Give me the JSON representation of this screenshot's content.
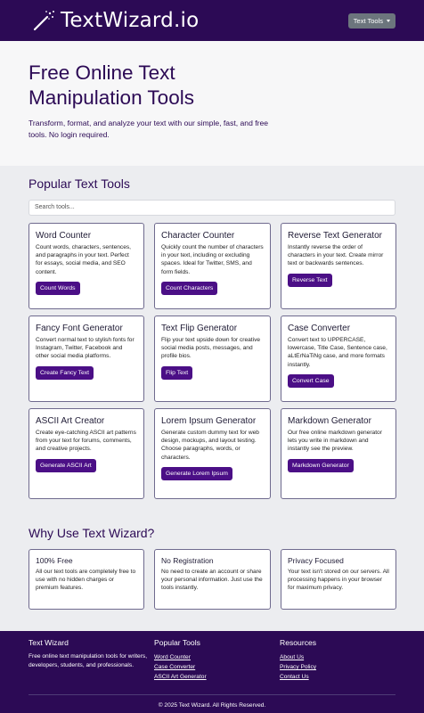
{
  "navbar": {
    "brand": "TextWizard.io",
    "dropdown_label": "Text Tools"
  },
  "hero": {
    "title": "Free Online Text Manipulation Tools",
    "subtitle": "Transform, format, and analyze your text with our simple, fast, and free tools. No login required."
  },
  "tools": {
    "title": "Popular Text Tools",
    "search_placeholder": "Search tools...",
    "cards": [
      {
        "title": "Word Counter",
        "desc": "Count words, characters, sentences, and paragraphs in your text. Perfect for essays, social media, and SEO content.",
        "button": "Count Words"
      },
      {
        "title": "Character Counter",
        "desc": "Quickly count the number of characters in your text, including or excluding spaces. Ideal for Twitter, SMS, and form fields.",
        "button": "Count Characters"
      },
      {
        "title": "Reverse Text Generator",
        "desc": "Instantly reverse the order of characters in your text. Create mirror text or backwards sentences.",
        "button": "Reverse Text"
      },
      {
        "title": "Fancy Font Generator",
        "desc": "Convert normal text to stylish fonts for Instagram, Twitter, Facebook and other social media platforms.",
        "button": "Create Fancy Text"
      },
      {
        "title": "Text Flip Generator",
        "desc": "Flip your text upside down for creative social media posts, messages, and profile bios.",
        "button": "Flip Text"
      },
      {
        "title": "Case Converter",
        "desc": "Convert text to UPPERCASE, lowercase, Title Case, Sentence case, aLtErNaTiNg case, and more formats instantly.",
        "button": "Convert Case"
      },
      {
        "title": "ASCII Art Creator",
        "desc": "Create eye-catching ASCII art patterns from your text for forums, comments, and creative projects.",
        "button": "Generate ASCII Art"
      },
      {
        "title": "Lorem Ipsum Generator",
        "desc": "Generate custom dummy text for web design, mockups, and layout testing. Choose paragraphs, words, or characters.",
        "button": "Generate Lorem Ipsum"
      },
      {
        "title": "Markdown Generator",
        "desc": "Our free online markdown generator lets you write in markdown and instantly see the preview.",
        "button": "Markdown Generator"
      }
    ]
  },
  "why": {
    "title": "Why Use Text Wizard?",
    "cards": [
      {
        "title": "100% Free",
        "desc": "All our text tools are completely free to use with no hidden charges or premium features."
      },
      {
        "title": "No Registration",
        "desc": "No need to create an account or share your personal information. Just use the tools instantly."
      },
      {
        "title": "Privacy Focused",
        "desc": "Your text isn't stored on our servers. All processing happens in your browser for maximum privacy."
      }
    ]
  },
  "footer": {
    "about_title": "Text Wizard",
    "about_text": "Free online text manipulation tools for writers, developers, students, and professionals.",
    "popular_title": "Popular Tools",
    "popular_links": [
      "Word Counter",
      "Case Converter",
      "ASCII Art Generator"
    ],
    "resources_title": "Resources",
    "resource_links": [
      "About Us",
      "Privacy Policy",
      "Contact Us"
    ],
    "copyright": "© 2025 Text Wizard. All Rights Reserved."
  },
  "colors": {
    "navbar_bg": "#2c0a55",
    "button_bg": "#4b0f86",
    "section_bg": "#ecedf0"
  },
  "icons": [
    "magic-wand-icon",
    "chevron-down-icon"
  ]
}
